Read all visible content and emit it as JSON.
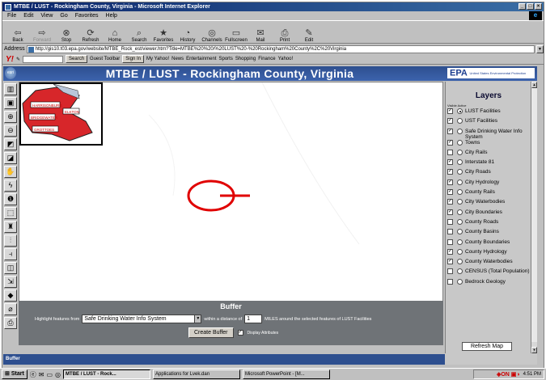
{
  "window": {
    "title": "MTBE / LUST - Rockingham County, Virginia - Microsoft Internet Explorer",
    "controls": [
      "_",
      "□",
      "×"
    ]
  },
  "menu": [
    "File",
    "Edit",
    "View",
    "Go",
    "Favorites",
    "Help"
  ],
  "toolbar": [
    {
      "label": "Back",
      "glyph": "⇦",
      "icon": "back-arrow-icon",
      "enabled": true
    },
    {
      "label": "Forward",
      "glyph": "⇨",
      "icon": "forward-arrow-icon",
      "enabled": false
    },
    {
      "label": "Stop",
      "glyph": "⊗",
      "icon": "stop-icon",
      "enabled": true
    },
    {
      "label": "Refresh",
      "glyph": "⟳",
      "icon": "refresh-icon",
      "enabled": true
    },
    {
      "label": "Home",
      "glyph": "⌂",
      "icon": "home-icon",
      "enabled": true
    },
    {
      "label": "Search",
      "glyph": "⌕",
      "icon": "search-icon",
      "enabled": true
    },
    {
      "label": "Favorites",
      "glyph": "★",
      "icon": "favorites-icon",
      "enabled": true
    },
    {
      "label": "History",
      "glyph": "◔",
      "icon": "history-icon",
      "enabled": true
    },
    {
      "label": "Channels",
      "glyph": "◎",
      "icon": "channels-icon",
      "enabled": true
    },
    {
      "label": "Fullscreen",
      "glyph": "▭",
      "icon": "fullscreen-icon",
      "enabled": true
    },
    {
      "label": "Mail",
      "glyph": "✉",
      "icon": "mail-icon",
      "enabled": true
    },
    {
      "label": "Print",
      "glyph": "⎙",
      "icon": "print-icon",
      "enabled": true
    },
    {
      "label": "Edit",
      "glyph": "✎",
      "icon": "edit-icon",
      "enabled": true
    }
  ],
  "address": {
    "label": "Address",
    "url": "http://gis10.t03.epa.gov/website/MTBE_Rock_est/viewer.htm?Title=MTBE%20%20/%20LUST%20-%20Rockingham%20County%2C%20Virginia"
  },
  "yahoo_toolbar": {
    "logo": "Y!",
    "search_button": "Search",
    "items": [
      "Guest Toolbar",
      "Sign In",
      "My Yahoo!",
      "News",
      "Entertainment",
      "Sports",
      "Shopping",
      "Finance",
      "Yahoo!"
    ]
  },
  "page": {
    "title": "MTBE / LUST - Rockingham County, Virginia",
    "esri_badge": "esri",
    "epa_logo": "EPA",
    "epa_subtitle": "United States Environmental Protection Agency"
  },
  "tools": [
    {
      "name": "toggle-legend-icon",
      "glyph": "▥"
    },
    {
      "name": "toggle-overview-icon",
      "glyph": "▣"
    },
    {
      "name": "zoom-in-icon",
      "glyph": "⊕"
    },
    {
      "name": "zoom-out-icon",
      "glyph": "⊖"
    },
    {
      "name": "full-extent-icon",
      "glyph": "◩"
    },
    {
      "name": "zoom-active-layer-icon",
      "glyph": "◪"
    },
    {
      "name": "pan-icon",
      "glyph": "✋"
    },
    {
      "name": "hyperlink-icon",
      "glyph": "ϟ"
    },
    {
      "name": "identify-icon",
      "glyph": "❶"
    },
    {
      "name": "select-by-rectangle-icon",
      "glyph": "⬚"
    },
    {
      "name": "find-icon",
      "glyph": "♜"
    },
    {
      "name": "measure-icon",
      "glyph": "⫶"
    },
    {
      "name": "select-by-line-icon",
      "glyph": "⫞"
    },
    {
      "name": "set-units-icon",
      "glyph": "◫"
    },
    {
      "name": "query-icon",
      "glyph": "⇲"
    },
    {
      "name": "buffer-icon",
      "glyph": "◆"
    },
    {
      "name": "clear-selection-icon",
      "glyph": "⌀"
    },
    {
      "name": "print-map-icon",
      "glyph": "⎙"
    }
  ],
  "overview": {
    "labels": [
      "HARRISONBURG",
      "BRIDGEWATER",
      "ELKTON",
      "GROTTOES"
    ]
  },
  "buffer": {
    "title": "Buffer",
    "highlight_label": "Highlight features from",
    "layer_selected": "Safe Drinking Water Info System",
    "distance_label": "within a distance of",
    "distance_value": "1",
    "suffix": "MILES around the selected features of LUST Facilities",
    "create_button": "Create Buffer",
    "display_attributes": "Display Attributes",
    "display_attributes_checked": true
  },
  "layers": {
    "title": "Layers",
    "col_visible": "Visible",
    "col_active": "Active",
    "items": [
      {
        "label": "LUST Facilities",
        "visible": true,
        "active": true
      },
      {
        "label": "UST Facilities",
        "visible": true,
        "active": false
      },
      {
        "label": "Safe Drinking Water Info System",
        "visible": true,
        "active": false
      },
      {
        "label": "Towns",
        "visible": true,
        "active": false
      },
      {
        "label": "City Rails",
        "visible": false,
        "active": false
      },
      {
        "label": "Interstate 81",
        "visible": true,
        "active": false
      },
      {
        "label": "City Roads",
        "visible": true,
        "active": false
      },
      {
        "label": "City Hydrology",
        "visible": true,
        "active": false
      },
      {
        "label": "County Rails",
        "visible": true,
        "active": false
      },
      {
        "label": "City Waterbodies",
        "visible": true,
        "active": false
      },
      {
        "label": "City Boundaries",
        "visible": true,
        "active": false
      },
      {
        "label": "County Roads",
        "visible": false,
        "active": false
      },
      {
        "label": "County Basins",
        "visible": false,
        "active": false
      },
      {
        "label": "County Boundaries",
        "visible": false,
        "active": false
      },
      {
        "label": "County Hydrology",
        "visible": true,
        "active": false
      },
      {
        "label": "County Waterbodies",
        "visible": true,
        "active": false
      },
      {
        "label": "CENSUS (Total Population)",
        "visible": false,
        "active": false
      },
      {
        "label": "Bedrock Geology",
        "visible": false,
        "active": false
      }
    ],
    "refresh_button": "Refresh Map"
  },
  "bottom_bar": {
    "label": "Buffer"
  },
  "taskbar": {
    "start": "Start",
    "tasks": [
      {
        "label": "MTBE / LUST - Rock...",
        "active": true
      },
      {
        "label": "Applications for Lvek.dan",
        "active": false
      },
      {
        "label": "Microsoft PowerPoint - [M...",
        "active": false
      }
    ],
    "tray_icons": "◈ON ▣◑",
    "clock": "4:51 PM"
  },
  "colors": {
    "header": "#2e4f8f",
    "buffer_panel": "#6f7377",
    "annotation": "#e00000",
    "overview_county": "#d7262a"
  }
}
